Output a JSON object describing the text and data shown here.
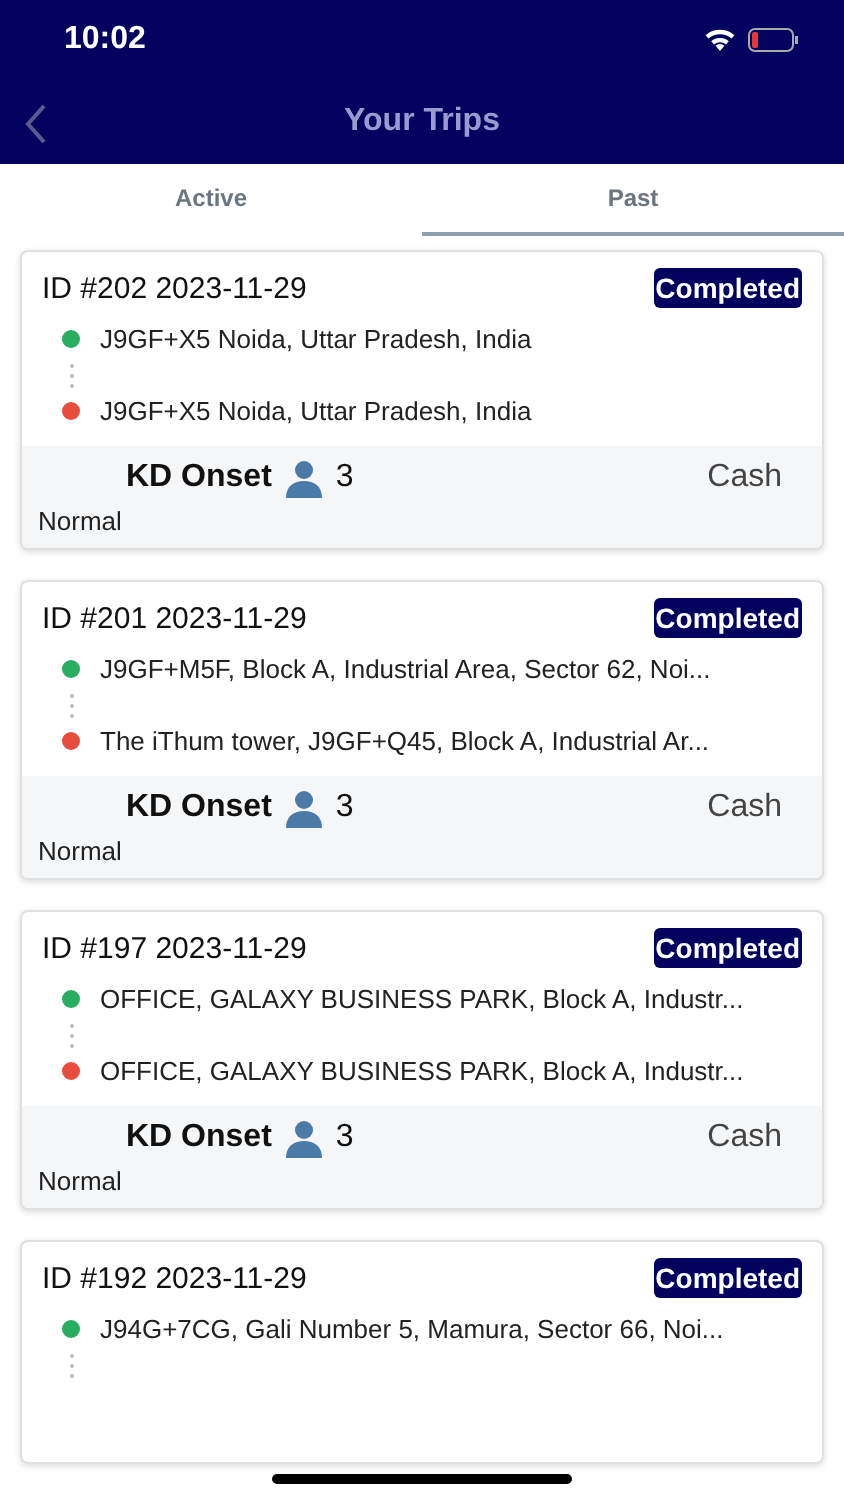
{
  "status_bar": {
    "time": "10:02"
  },
  "header": {
    "title": "Your Trips"
  },
  "tabs": [
    {
      "label": "Active",
      "selected": false
    },
    {
      "label": "Past",
      "selected": true
    }
  ],
  "trips": [
    {
      "id": "ID #202 2023-11-29",
      "status": "Completed",
      "pickup": "J9GF+X5 Noida, Uttar Pradesh, India",
      "dropoff": "J9GF+X5 Noida, Uttar Pradesh, India",
      "vehicle": "KD Onset",
      "seats": "3",
      "payment": "Cash",
      "category": "Normal"
    },
    {
      "id": "ID #201 2023-11-29",
      "status": "Completed",
      "pickup": "J9GF+M5F, Block A, Industrial Area, Sector 62, Noi...",
      "dropoff": "The iThum tower, J9GF+Q45, Block A, Industrial Ar...",
      "vehicle": "KD Onset",
      "seats": "3",
      "payment": "Cash",
      "category": "Normal"
    },
    {
      "id": "ID #197 2023-11-29",
      "status": "Completed",
      "pickup": "OFFICE, GALAXY BUSINESS PARK, Block A, Industr...",
      "dropoff": "OFFICE, GALAXY BUSINESS PARK, Block A, Industr...",
      "vehicle": "KD Onset",
      "seats": "3",
      "payment": "Cash",
      "category": "Normal"
    },
    {
      "id": "ID #192 2023-11-29",
      "status": "Completed",
      "pickup": "J94G+7CG, Gali Number 5, Mamura, Sector 66, Noi..."
    }
  ]
}
